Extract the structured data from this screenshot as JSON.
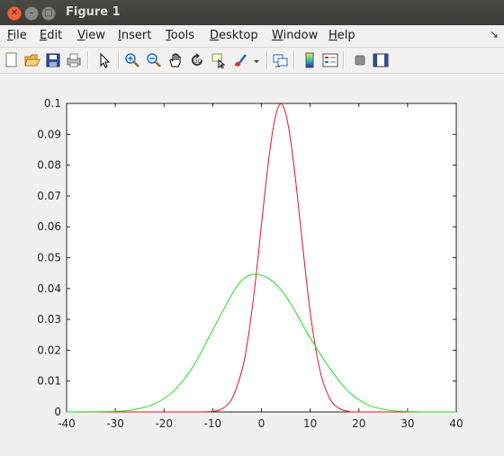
{
  "window": {
    "title": "Figure 1"
  },
  "menu": [
    "File",
    "Edit",
    "View",
    "Insert",
    "Tools",
    "Desktop",
    "Window",
    "Help"
  ],
  "menu_mnemonics": [
    "F",
    "E",
    "V",
    "I",
    "T",
    "D",
    "W",
    "H"
  ],
  "dock_glyph": "↘",
  "toolbar_icons": [
    "new-figure-icon",
    "open-file-icon",
    "save-icon",
    "print-icon",
    "edit-plot-pointer-icon",
    "zoom-in-icon",
    "zoom-out-icon",
    "pan-hand-icon",
    "rotate-3d-icon",
    "data-cursor-icon",
    "brush-icon",
    "brush-dropdown-icon",
    "link-plot-icon",
    "colorbar-icon",
    "legend-icon",
    "hide-plot-tools-icon",
    "show-plot-tools-icon"
  ],
  "colors": {
    "series_narrow": "#e8141e",
    "series_wide": "#1fe01f",
    "axes_bg": "#ffffff"
  },
  "chart_data": {
    "type": "line",
    "xlim": [
      -40,
      40
    ],
    "ylim": [
      0,
      0.1
    ],
    "x_ticks": [
      -40,
      -30,
      -20,
      -10,
      0,
      10,
      20,
      30,
      40
    ],
    "y_ticks": [
      0,
      0.01,
      0.02,
      0.03,
      0.04,
      0.05,
      0.06,
      0.07,
      0.08,
      0.09,
      0.1
    ],
    "x_tick_labels": [
      "-40",
      "-30",
      "-20",
      "-10",
      "0",
      "10",
      "20",
      "30",
      "40"
    ],
    "y_tick_labels": [
      "0",
      "0.01",
      "0.02",
      "0.03",
      "0.04",
      "0.05",
      "0.06",
      "0.07",
      "0.08",
      "0.09",
      "0.1"
    ],
    "grid": false,
    "series": [
      {
        "color": "#e8141e",
        "x": [
          -40,
          -15,
          -10,
          -8,
          -6,
          -4,
          -3,
          -2,
          -1,
          0,
          1,
          2,
          3,
          4,
          5,
          6,
          7,
          8,
          10,
          12,
          14,
          16,
          18,
          20,
          40
        ],
        "y": [
          0,
          0,
          0.0002,
          0.0011,
          0.0044,
          0.0135,
          0.0214,
          0.0324,
          0.0457,
          0.0607,
          0.0753,
          0.0879,
          0.0966,
          0.0999,
          0.0966,
          0.0879,
          0.0753,
          0.0607,
          0.0324,
          0.0135,
          0.0044,
          0.0011,
          0.0002,
          0,
          0
        ]
      },
      {
        "color": "#1fe01f",
        "x": [
          -40,
          -30,
          -26,
          -22,
          -18,
          -14,
          -10,
          -6,
          -4,
          -2,
          0,
          2,
          4,
          6,
          8,
          10,
          14,
          18,
          22,
          26,
          30,
          34,
          40
        ],
        "y": [
          0,
          0.0002,
          0.0008,
          0.0026,
          0.0068,
          0.0148,
          0.0266,
          0.0383,
          0.0427,
          0.0445,
          0.0443,
          0.0427,
          0.0396,
          0.0351,
          0.0296,
          0.024,
          0.0142,
          0.0064,
          0.0022,
          0.0006,
          0.0001,
          0,
          0
        ]
      }
    ]
  }
}
